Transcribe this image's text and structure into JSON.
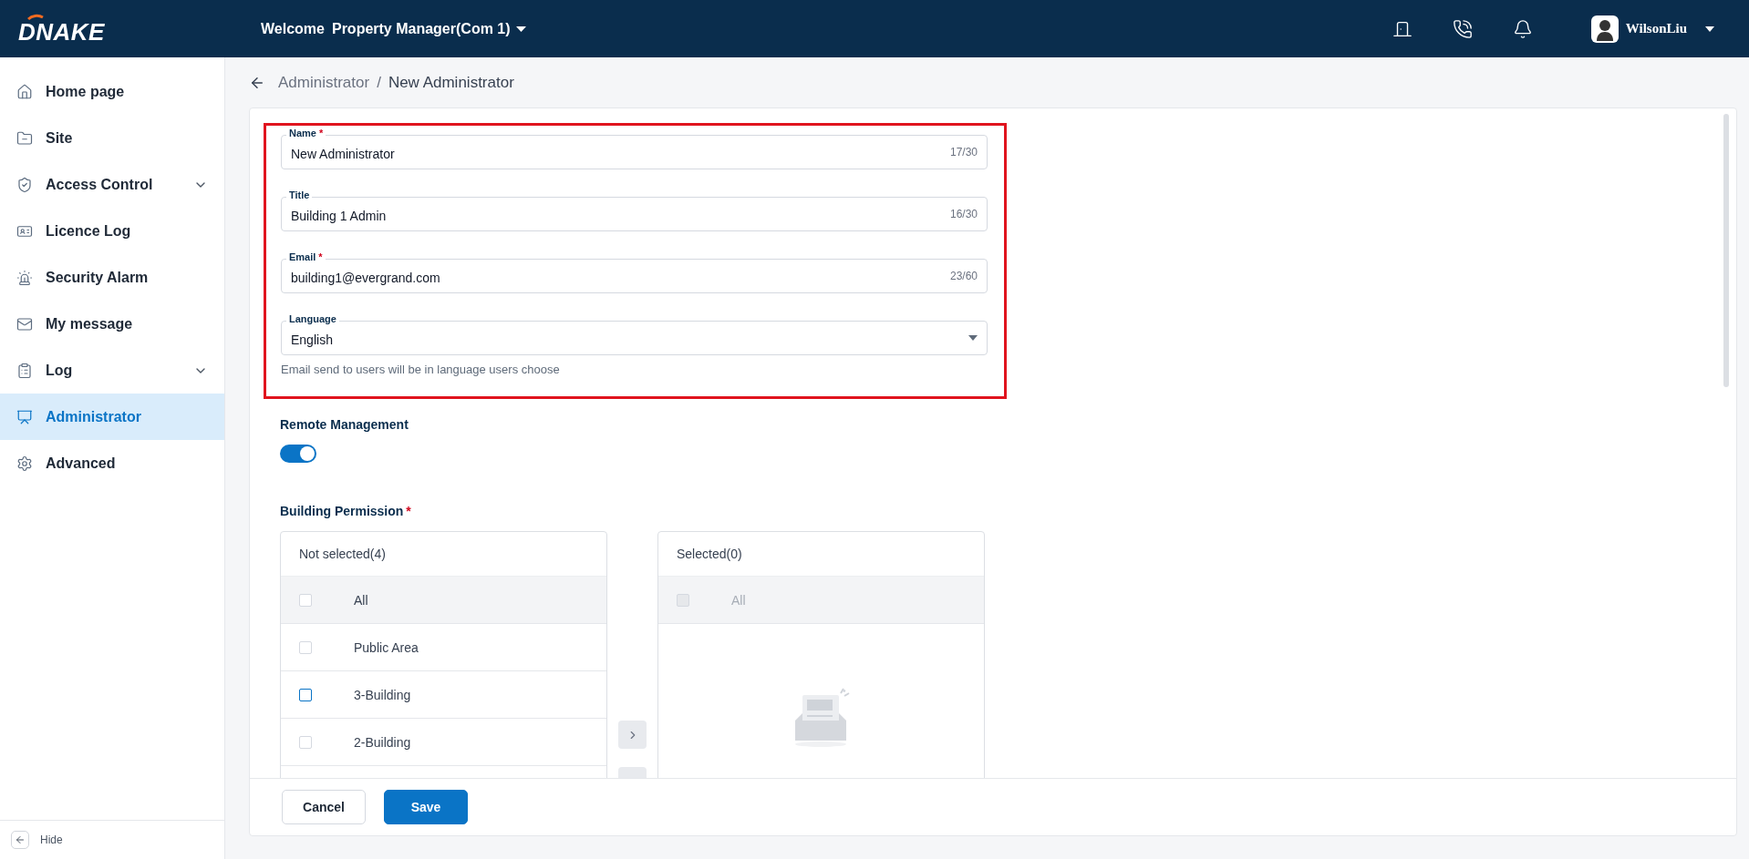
{
  "header": {
    "logo": "DNAKE",
    "welcome": "Welcome",
    "role": "Property Manager(Com 1)",
    "user": "WilsonLiu"
  },
  "sidebar": {
    "items": [
      {
        "label": "Home page",
        "expandable": false,
        "selected": false
      },
      {
        "label": "Site",
        "expandable": false,
        "selected": false
      },
      {
        "label": "Access Control",
        "expandable": true,
        "selected": false
      },
      {
        "label": "Licence Log",
        "expandable": false,
        "selected": false
      },
      {
        "label": "Security Alarm",
        "expandable": false,
        "selected": false
      },
      {
        "label": "My message",
        "expandable": false,
        "selected": false
      },
      {
        "label": "Log",
        "expandable": true,
        "selected": false
      },
      {
        "label": "Administrator",
        "expandable": false,
        "selected": true
      },
      {
        "label": "Advanced",
        "expandable": false,
        "selected": false
      }
    ],
    "hide": "Hide"
  },
  "breadcrumb": {
    "parent": "Administrator",
    "separator": "/",
    "current": "New Administrator"
  },
  "form": {
    "fields": [
      {
        "kind": "text",
        "label": "Name",
        "required": true,
        "value": "New Administrator",
        "counter": "17/30"
      },
      {
        "kind": "text",
        "label": "Title",
        "required": false,
        "value": "Building 1 Admin",
        "counter": "16/30"
      },
      {
        "kind": "text",
        "label": "Email",
        "required": true,
        "value": "building1@evergrand.com",
        "counter": "23/60"
      },
      {
        "kind": "select",
        "label": "Language",
        "required": false,
        "value": "English"
      }
    ],
    "required_mark": "*",
    "helper": "Email send to users will be in language users choose",
    "remote_management": {
      "label": "Remote Management",
      "on": true
    },
    "building_permission": {
      "label": "Building Permission",
      "required": true,
      "lists": [
        {
          "title": "Not selected(4)",
          "all": {
            "label": "All",
            "checked": false,
            "disabled": false
          },
          "items": [
            {
              "label": "Public Area",
              "checked": false,
              "hovered": false
            },
            {
              "label": "3-Building",
              "checked": false,
              "hovered": true
            },
            {
              "label": "2-Building",
              "checked": false,
              "hovered": false
            }
          ]
        },
        {
          "title": "Selected(0)",
          "all": {
            "label": "All",
            "checked": false,
            "disabled": true
          }
        }
      ]
    }
  },
  "buttons": {
    "cancel": "Cancel",
    "save": "Save"
  }
}
